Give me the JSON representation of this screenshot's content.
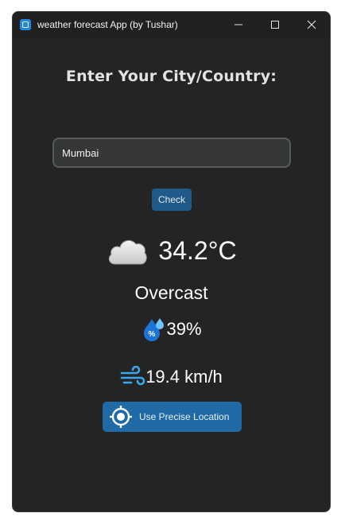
{
  "window": {
    "title": "weather forecast App (by Tushar)"
  },
  "form": {
    "heading": "Enter Your City/Country:",
    "city_value": "Mumbai",
    "check_label": "Check"
  },
  "weather": {
    "condition_icon": "cloud-icon",
    "temperature": "34.2°C",
    "condition": "Overcast",
    "humidity_icon": "humidity-drop-icon",
    "humidity": "39%",
    "wind_icon": "wind-icon",
    "wind_speed": "19.4 km/h"
  },
  "location": {
    "button_label": "Use Precise Location",
    "icon": "crosshair-icon"
  },
  "colors": {
    "window_bg": "#242424",
    "accent": "#1f6aa5",
    "text": "#ffffff"
  }
}
